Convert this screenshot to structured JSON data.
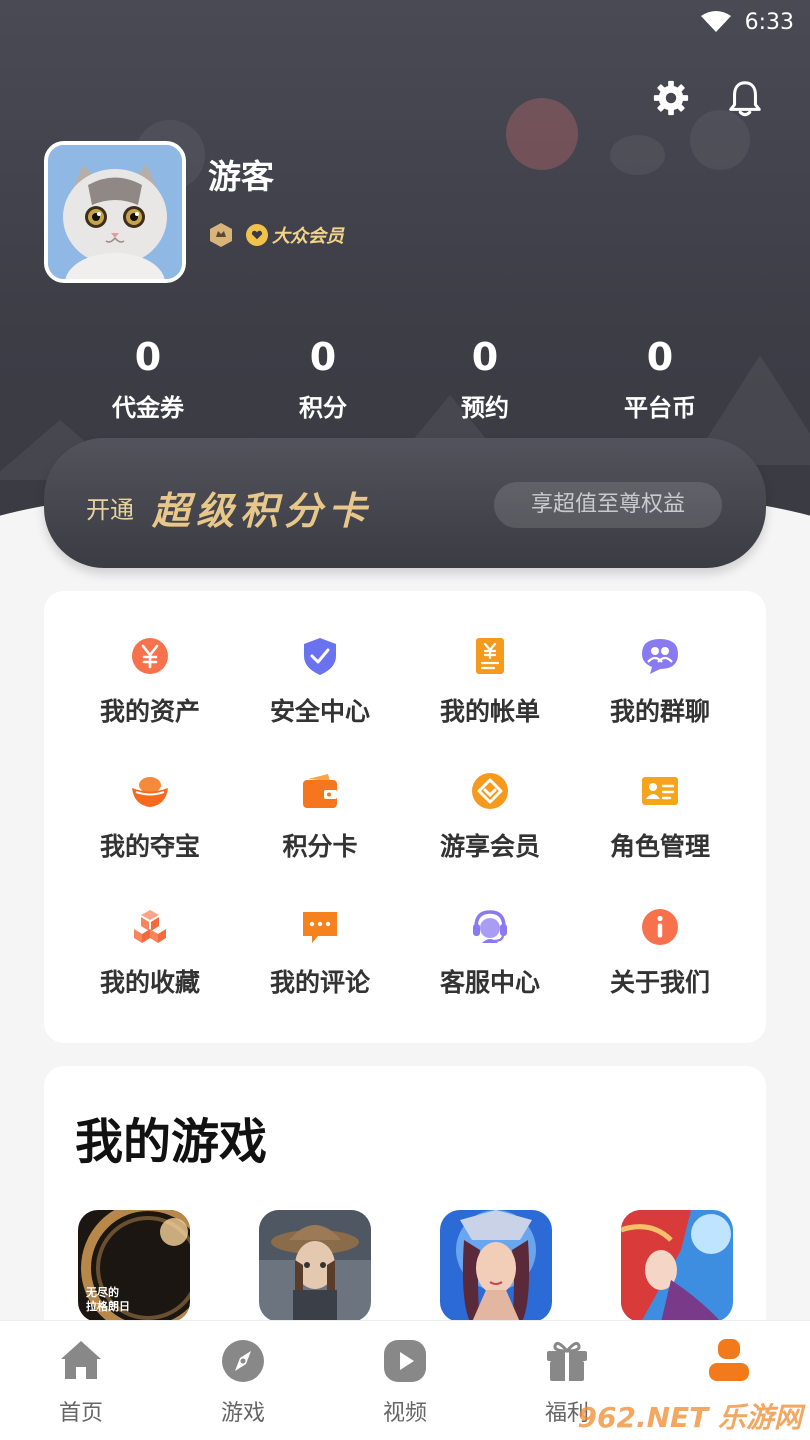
{
  "status_bar": {
    "time": "6:33"
  },
  "profile": {
    "username": "游客",
    "member_label": "大众会员"
  },
  "stats": [
    {
      "value": "0",
      "label": "代金券"
    },
    {
      "value": "0",
      "label": "积分"
    },
    {
      "value": "0",
      "label": "预约"
    },
    {
      "value": "0",
      "label": "平台币"
    }
  ],
  "vip_banner": {
    "open_text": "开通",
    "title": "超级积分卡",
    "button": "享超值至尊权益"
  },
  "menu": [
    {
      "label": "我的资产",
      "icon": "yuan-coin-icon",
      "color": "#f7714c"
    },
    {
      "label": "安全中心",
      "icon": "shield-check-icon",
      "color": "#6b72f0"
    },
    {
      "label": "我的帐单",
      "icon": "bill-icon",
      "color": "#f59a1c"
    },
    {
      "label": "我的群聊",
      "icon": "group-chat-icon",
      "color": "#8a7af2"
    },
    {
      "label": "我的夺宝",
      "icon": "gold-ingot-icon",
      "color": "#f56a1c"
    },
    {
      "label": "积分卡",
      "icon": "wallet-icon",
      "color": "#f5761c"
    },
    {
      "label": "游享会员",
      "icon": "member-diamond-icon",
      "color": "#f59a1c"
    },
    {
      "label": "角色管理",
      "icon": "id-card-icon",
      "color": "#f5a51c"
    },
    {
      "label": "我的收藏",
      "icon": "cubes-icon",
      "color": "#f7855c"
    },
    {
      "label": "我的评论",
      "icon": "comment-icon",
      "color": "#f5821c"
    },
    {
      "label": "客服中心",
      "icon": "headset-icon",
      "color": "#8a7af2"
    },
    {
      "label": "关于我们",
      "icon": "info-icon",
      "color": "#f7714c"
    }
  ],
  "games_section": {
    "title": "我的游戏",
    "first_game_art_text": "无尽的拉格朗日"
  },
  "tabbar": [
    {
      "label": "首页",
      "icon": "home-icon"
    },
    {
      "label": "游戏",
      "icon": "compass-icon"
    },
    {
      "label": "视频",
      "icon": "play-icon"
    },
    {
      "label": "福利",
      "icon": "gift-icon"
    },
    {
      "label": "",
      "icon": "profile-icon",
      "active": true
    }
  ],
  "watermark": "962.NET 乐游网",
  "colors": {
    "accent": "#f27a1a",
    "header_bg": "#42424b",
    "gold": "#e8c88a"
  }
}
